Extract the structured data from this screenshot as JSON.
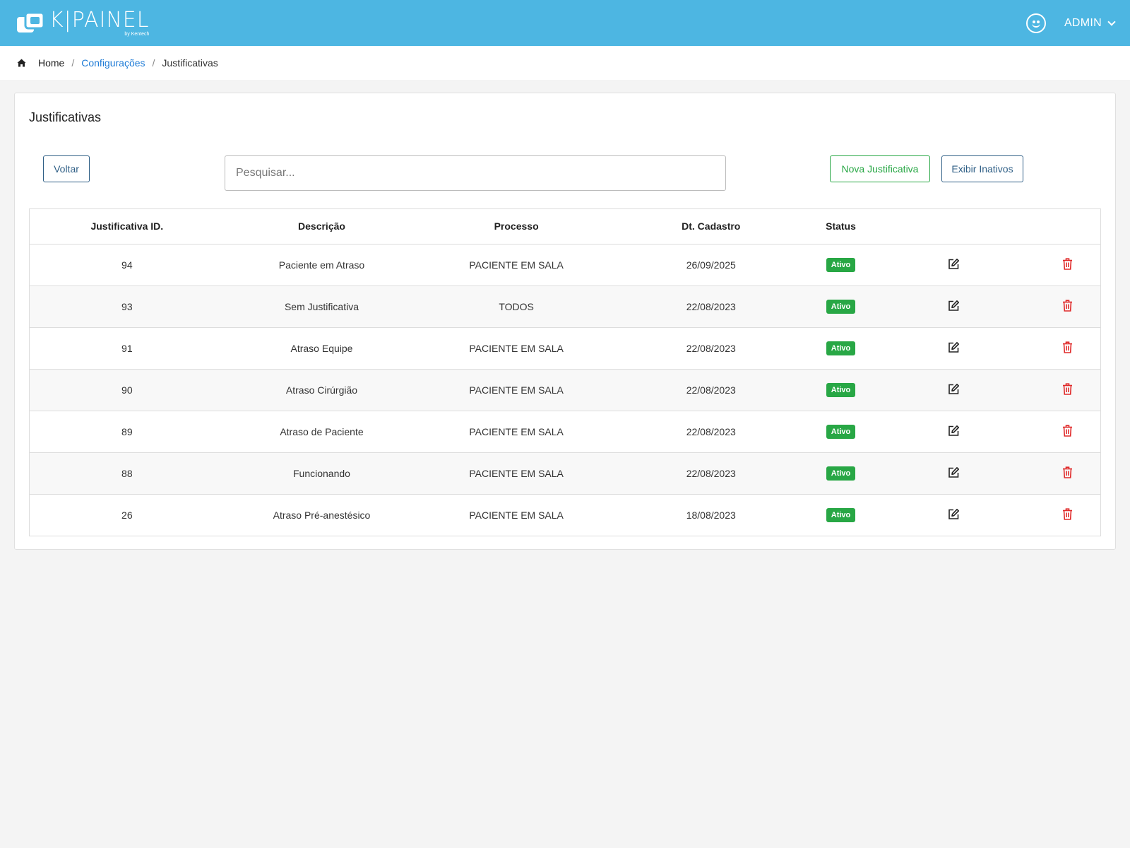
{
  "header": {
    "logo_text": "K|PAINEL",
    "logo_sub": "by Kentech",
    "user_label": "ADMIN"
  },
  "breadcrumb": {
    "home": "Home",
    "sep": "/",
    "configuracoes": "Configurações",
    "current": "Justificativas"
  },
  "page": {
    "title": "Justificativas",
    "voltar_label": "Voltar",
    "search_placeholder": "Pesquisar...",
    "nova_label": "Nova Justificativa",
    "exibir_inativos_label": "Exibir Inativos"
  },
  "table": {
    "headers": [
      "Justificativa ID.",
      "Descrição",
      "Processo",
      "Dt. Cadastro",
      "Status"
    ],
    "rows": [
      {
        "id": "94",
        "descricao": "Paciente em Atraso",
        "processo": "PACIENTE EM SALA",
        "dt": "26/09/2025",
        "status": "Ativo"
      },
      {
        "id": "93",
        "descricao": "Sem Justificativa",
        "processo": "TODOS",
        "dt": "22/08/2023",
        "status": "Ativo"
      },
      {
        "id": "91",
        "descricao": "Atraso Equipe",
        "processo": "PACIENTE EM SALA",
        "dt": "22/08/2023",
        "status": "Ativo"
      },
      {
        "id": "90",
        "descricao": "Atraso Cirúrgião",
        "processo": "PACIENTE EM SALA",
        "dt": "22/08/2023",
        "status": "Ativo"
      },
      {
        "id": "89",
        "descricao": "Atraso de Paciente",
        "processo": "PACIENTE EM SALA",
        "dt": "22/08/2023",
        "status": "Ativo"
      },
      {
        "id": "88",
        "descricao": "Funcionando",
        "processo": "PACIENTE EM SALA",
        "dt": "22/08/2023",
        "status": "Ativo"
      },
      {
        "id": "26",
        "descricao": "Atraso Pré-anestésico",
        "processo": "PACIENTE EM SALA",
        "dt": "18/08/2023",
        "status": "Ativo"
      }
    ]
  },
  "icons": {
    "logo": "logo-icon",
    "user": "smile-icon",
    "dropdown": "chevron-down-icon",
    "home": "home-icon",
    "edit": "edit-icon",
    "delete": "trash-icon"
  },
  "colors": {
    "header_bg": "#4db6e2",
    "active_badge": "#28a745",
    "delete_icon": "#e02a2a",
    "link": "#1e7bd6",
    "primary_outline": "#2f5f86"
  }
}
